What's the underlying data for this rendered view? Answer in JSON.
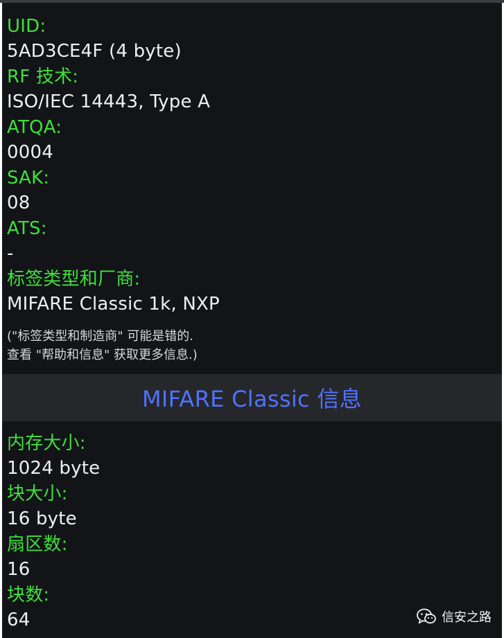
{
  "card": {
    "uid_label": "UID:",
    "uid_value": "5AD3CE4F (4 byte)",
    "rf_label": "RF 技术:",
    "rf_value": "ISO/IEC 14443, Type A",
    "atqa_label": "ATQA:",
    "atqa_value": "0004",
    "sak_label": "SAK:",
    "sak_value": "08",
    "ats_label": "ATS:",
    "ats_value": "-",
    "type_label": "标签类型和厂商:",
    "type_value": "MIFARE Classic 1k, NXP",
    "note_line1": "(\"标签类型和制造商\" 可能是错的.",
    "note_line2": "查看 \"帮助和信息\" 获取更多信息.)"
  },
  "mifare": {
    "header": "MIFARE Classic 信息",
    "mem_label": "内存大小:",
    "mem_value": "1024 byte",
    "block_size_label": "块大小:",
    "block_size_value": "16 byte",
    "sectors_label": "扇区数:",
    "sectors_value": "16",
    "blocks_label": "块数:",
    "blocks_value": "64"
  },
  "watermark": {
    "text": "信安之路",
    "icon": "wechat-icon"
  },
  "colors": {
    "background": "#121418",
    "label": "#3fe03a",
    "value": "#f0f0f0",
    "header_text": "#4f73ff",
    "header_band": "#25272b"
  }
}
